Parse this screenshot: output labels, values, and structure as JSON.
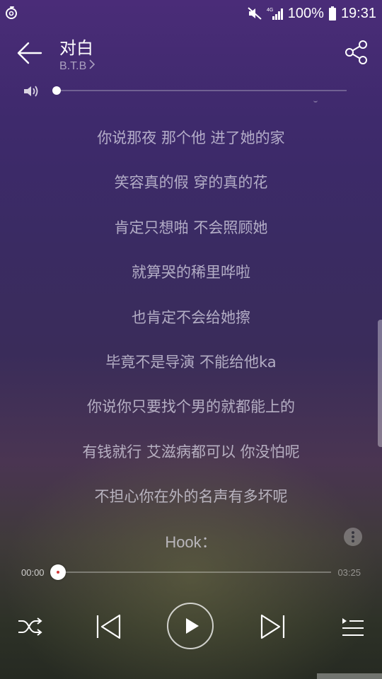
{
  "status_bar": {
    "app_icon": "netease-music-icon",
    "mute_icon": "mute-icon",
    "signal_icon": "signal-4g-icon",
    "battery_text": "100%",
    "battery_icon": "battery-icon",
    "time": "19:31"
  },
  "header": {
    "back_icon": "arrow-left-icon",
    "song_title": "对白",
    "artist": "B.T.B",
    "artist_chevron": ">",
    "share_icon": "share-icon"
  },
  "volume": {
    "icon": "speaker-icon",
    "level": 0.0
  },
  "lyrics": [
    "你说那夜 那个他 进了她的家",
    "笑容真的假 穿的真的花",
    "肯定只想啪 不会照顾她",
    "就算哭的稀里哗啦",
    "也肯定不会给她擦",
    "毕竟不是导演 不能给他ka",
    "你说你只要找个男的就都能上的",
    "有钱就行 艾滋病都可以 你没怕呢",
    "不担心你在外的名声有多坏呢",
    "Hook："
  ],
  "progress": {
    "current_time": "00:00",
    "total_time": "03:25",
    "fraction": 0.0
  },
  "controls": {
    "shuffle_icon": "shuffle-icon",
    "prev_icon": "skip-previous-icon",
    "play_icon": "play-icon",
    "next_icon": "skip-next-icon",
    "playlist_icon": "playlist-icon"
  },
  "more_icon": "more-vertical-icon",
  "colors": {
    "accent_dot": "#d33a3a",
    "lyric_text": "#e1deec"
  }
}
